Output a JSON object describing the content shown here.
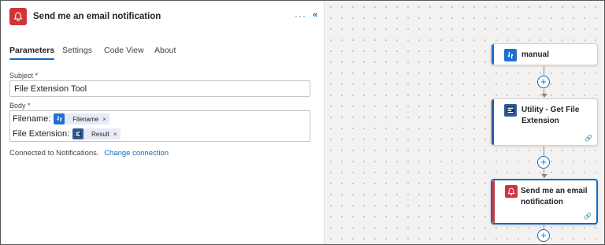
{
  "header": {
    "title": "Send me an email notification",
    "icon": "bell-icon",
    "more": "···",
    "collapse": "«"
  },
  "tabs": [
    {
      "label": "Parameters",
      "active": true
    },
    {
      "label": "Settings",
      "active": false
    },
    {
      "label": "Code View",
      "active": false
    },
    {
      "label": "About",
      "active": false
    }
  ],
  "subject": {
    "label": "Subject *",
    "value": "File Extension Tool"
  },
  "body": {
    "label": "Body *",
    "lines": [
      {
        "text": "Filename:",
        "token": {
          "label": "Filename",
          "icon": "manual-trigger-icon",
          "remove": "×"
        }
      },
      {
        "text": "File Extension:",
        "token": {
          "label": "Result",
          "icon": "utility-icon",
          "remove": "×"
        }
      }
    ]
  },
  "connection": {
    "text": "Connected to Notifications.",
    "link": "Change connection"
  },
  "flow": {
    "nodes": [
      {
        "title": "manual",
        "icon": "manual-trigger-icon"
      },
      {
        "title": "Utility - Get File Extension",
        "icon": "utility-icon"
      },
      {
        "title": "Send me an email notification",
        "icon": "bell-icon"
      }
    ],
    "add_symbol": "+",
    "link_symbol": "🔗"
  },
  "colors": {
    "accent": "#0f6cbd",
    "notification_red": "#d13438",
    "trigger_blue": "#1f6fd1"
  }
}
